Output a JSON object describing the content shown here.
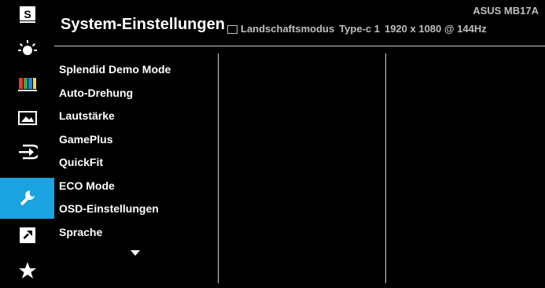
{
  "header": {
    "title": "System-Einstellungen",
    "model": "ASUS MB17A",
    "status": {
      "mode": "Landschaftsmodus",
      "input": "Type-c 1",
      "resolution": "1920 x 1080 @ 144Hz"
    }
  },
  "sidebar": {
    "items": [
      {
        "icon": "splendid-s-icon",
        "active": false
      },
      {
        "icon": "brightness-icon",
        "active": false
      },
      {
        "icon": "color-bars-icon",
        "active": false
      },
      {
        "icon": "image-icon",
        "active": false
      },
      {
        "icon": "input-select-icon",
        "active": false
      },
      {
        "icon": "wrench-icon",
        "active": true
      },
      {
        "icon": "shortcut-icon",
        "active": false
      },
      {
        "icon": "favorite-star-icon",
        "active": false
      }
    ]
  },
  "menu": {
    "items": [
      "Splendid Demo Mode",
      "Auto-Drehung",
      "Lautstärke",
      "GamePlus",
      "QuickFit",
      "ECO Mode",
      "OSD-Einstellungen",
      "Sprache"
    ],
    "more_indicator": "chevron-down-icon"
  },
  "colors": {
    "accent": "#1aa3e0",
    "background": "#000000",
    "text": "#ffffff",
    "secondary_text": "#bfbfbf"
  }
}
